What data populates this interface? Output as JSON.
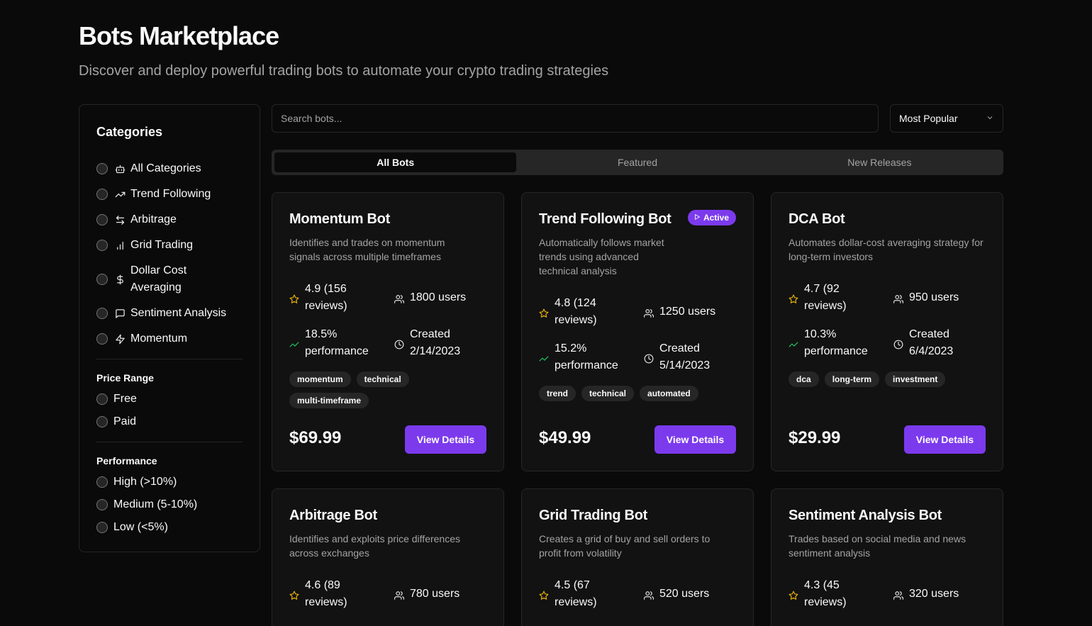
{
  "header": {
    "title": "Bots Marketplace",
    "subtitle": "Discover and deploy powerful trading bots to automate your crypto trading strategies"
  },
  "sidebar": {
    "title": "Categories",
    "categories": [
      {
        "label": "All Categories",
        "icon": "bot-icon"
      },
      {
        "label": "Trend Following",
        "icon": "trending-up-icon"
      },
      {
        "label": "Arbitrage",
        "icon": "arrows-exchange-icon"
      },
      {
        "label": "Grid Trading",
        "icon": "bar-chart-icon"
      },
      {
        "label": "Dollar Cost Averaging",
        "icon": "dollar-icon"
      },
      {
        "label": "Sentiment Analysis",
        "icon": "message-icon"
      },
      {
        "label": "Momentum",
        "icon": "zap-icon"
      }
    ],
    "price_range": {
      "title": "Price Range",
      "options": [
        "Free",
        "Paid"
      ]
    },
    "performance": {
      "title": "Performance",
      "options": [
        "High (>10%)",
        "Medium (5-10%)",
        "Low (<5%)"
      ]
    }
  },
  "search": {
    "placeholder": "Search bots..."
  },
  "sort": {
    "selected": "Most Popular"
  },
  "tabs": [
    {
      "label": "All Bots",
      "active": true
    },
    {
      "label": "Featured",
      "active": false
    },
    {
      "label": "New Releases",
      "active": false
    }
  ],
  "bots": [
    {
      "name": "Momentum Bot",
      "description": "Identifies and trades on momentum signals across multiple timeframes",
      "rating": "4.9 (156 reviews)",
      "users": "1800 users",
      "performance": "18.5% performance",
      "created": "Created 2/14/2023",
      "tags": [
        "momentum",
        "technical",
        "multi-timeframe"
      ],
      "price": "$69.99",
      "button": "View Details"
    },
    {
      "name": "Trend Following Bot",
      "badge": "Active",
      "description": "Automatically follows market trends using advanced technical analysis",
      "rating": "4.8 (124 reviews)",
      "users": "1250 users",
      "performance": "15.2% performance",
      "created": "Created 5/14/2023",
      "tags": [
        "trend",
        "technical",
        "automated"
      ],
      "price": "$49.99",
      "button": "View Details"
    },
    {
      "name": "DCA Bot",
      "description": "Automates dollar-cost averaging strategy for long-term investors",
      "rating": "4.7 (92 reviews)",
      "users": "950 users",
      "performance": "10.3% performance",
      "created": "Created 6/4/2023",
      "tags": [
        "dca",
        "long-term",
        "investment"
      ],
      "price": "$29.99",
      "button": "View Details"
    },
    {
      "name": "Arbitrage Bot",
      "description": "Identifies and exploits price differences across exchanges",
      "rating": "4.6 (89 reviews)",
      "users": "780 users"
    },
    {
      "name": "Grid Trading Bot",
      "description": "Creates a grid of buy and sell orders to profit from volatility",
      "rating": "4.5 (67 reviews)",
      "users": "520 users"
    },
    {
      "name": "Sentiment Analysis Bot",
      "description": "Trades based on social media and news sentiment analysis",
      "rating": "4.3 (45 reviews)",
      "users": "320 users"
    }
  ],
  "colors": {
    "accent": "#7c3aed",
    "star": "#eab308",
    "performance": "#22c55e",
    "background": "#0a0a0a",
    "card": "#121212"
  }
}
